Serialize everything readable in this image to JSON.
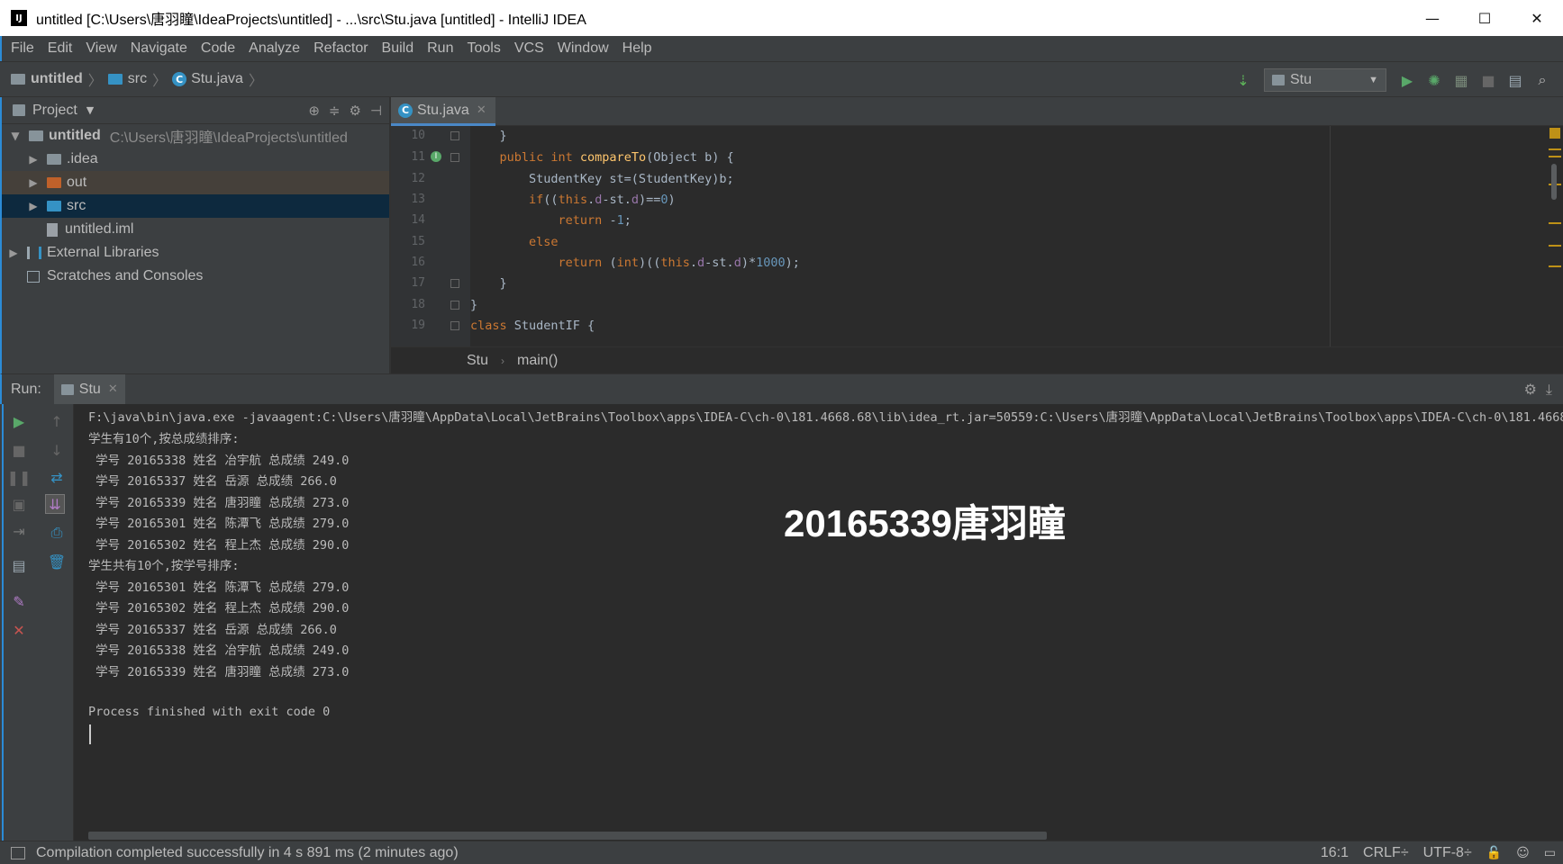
{
  "window": {
    "title": "untitled [C:\\Users\\唐羽瞳\\IdeaProjects\\untitled] - ...\\src\\Stu.java [untitled] - IntelliJ IDEA",
    "app_icon": "IJ",
    "minimize": "—",
    "maximize": "☐",
    "close": "✕"
  },
  "menu": [
    "File",
    "Edit",
    "View",
    "Navigate",
    "Code",
    "Analyze",
    "Refactor",
    "Build",
    "Run",
    "Tools",
    "VCS",
    "Window",
    "Help"
  ],
  "navbar": {
    "crumbs": [
      "untitled",
      "src",
      "Stu.java"
    ],
    "run_config": "Stu"
  },
  "project": {
    "header": "Project",
    "root_name": "untitled",
    "root_path": "C:\\Users\\唐羽瞳\\IdeaProjects\\untitled",
    "items": [
      ".idea",
      "out",
      "src",
      "untitled.iml"
    ],
    "external_libraries": "External Libraries",
    "scratches": "Scratches and Consoles"
  },
  "editor": {
    "tab": "Stu.java",
    "line_numbers": [
      "10",
      "11",
      "12",
      "13",
      "14",
      "15",
      "16",
      "17",
      "18",
      "19"
    ],
    "breadcrumb": [
      "Stu",
      "main()"
    ]
  },
  "run": {
    "label": "Run:",
    "tab": "Stu",
    "command": "F:\\java\\bin\\java.exe -javaagent:C:\\Users\\唐羽瞳\\AppData\\Local\\JetBrains\\Toolbox\\apps\\IDEA-C\\ch-0\\181.4668.68\\lib\\idea_rt.jar=50559:C:\\Users\\唐羽瞳\\AppData\\Local\\JetBrains\\Toolbox\\apps\\IDEA-C\\ch-0\\181.4668.",
    "lines": [
      "学生有10个,按总成绩排序:",
      " 学号 20165338 姓名 冶宇航 总成绩 249.0",
      " 学号 20165337 姓名 岳源 总成绩 266.0",
      " 学号 20165339 姓名 唐羽瞳 总成绩 273.0",
      " 学号 20165301 姓名 陈潭飞 总成绩 279.0",
      " 学号 20165302 姓名 程上杰 总成绩 290.0",
      "学生共有10个,按学号排序:",
      " 学号 20165301 姓名 陈潭飞 总成绩 279.0",
      " 学号 20165302 姓名 程上杰 总成绩 290.0",
      " 学号 20165337 姓名 岳源 总成绩 266.0",
      " 学号 20165338 姓名 冶宇航 总成绩 249.0",
      " 学号 20165339 姓名 唐羽瞳 总成绩 273.0"
    ],
    "exit": "Process finished with exit code 0",
    "watermark": "20165339唐羽瞳"
  },
  "status": {
    "message": "Compilation completed successfully in 4 s 891 ms (2 minutes ago)",
    "position": "16:1",
    "line_sep": "CRLF÷",
    "encoding": "UTF-8÷"
  },
  "colors": {
    "accent": "#2b8bd6",
    "keyword": "#cc7832",
    "function": "#ffc66d",
    "field": "#9876aa",
    "number": "#6897bb"
  }
}
